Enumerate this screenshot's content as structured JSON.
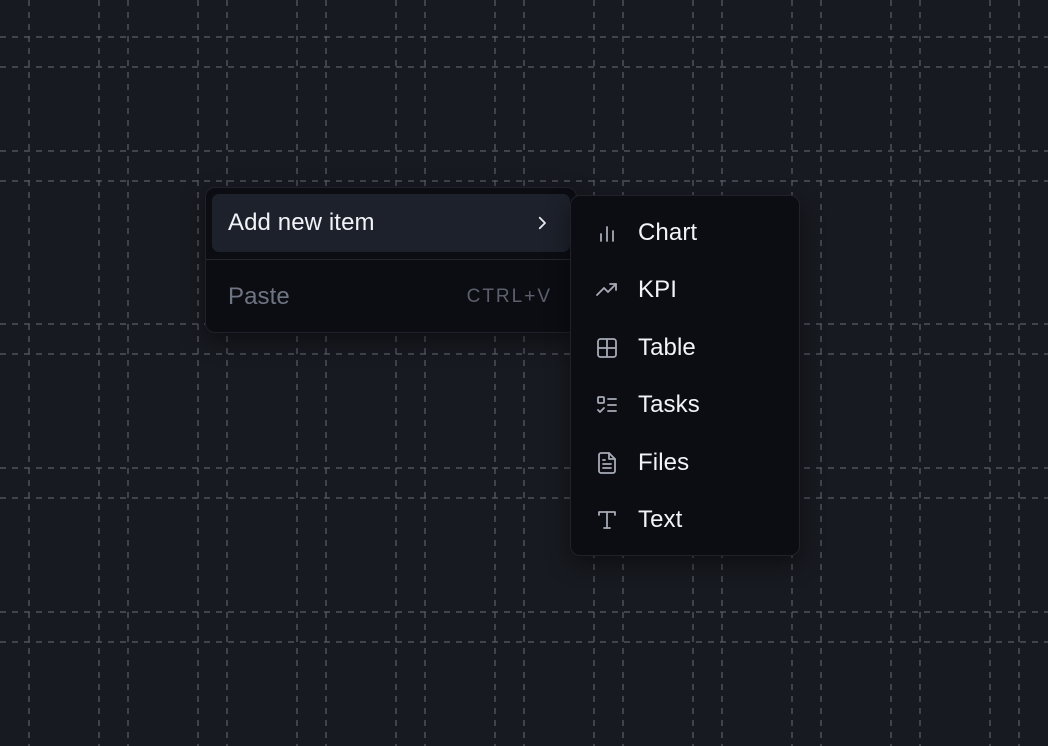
{
  "context_menu": {
    "add_item_label": "Add new item",
    "paste_label": "Paste",
    "paste_shortcut": "CTRL+V"
  },
  "submenu": {
    "items": [
      {
        "label": "Chart",
        "icon": "bar-chart-icon"
      },
      {
        "label": "KPI",
        "icon": "trending-up-icon"
      },
      {
        "label": "Table",
        "icon": "table-grid-icon"
      },
      {
        "label": "Tasks",
        "icon": "task-list-icon"
      },
      {
        "label": "Files",
        "icon": "file-icon"
      },
      {
        "label": "Text",
        "icon": "text-type-icon"
      }
    ]
  },
  "colors": {
    "background": "#181a21",
    "menu_background": "#0b0d13",
    "highlight": "#1d212b",
    "text": "#f1f3f7",
    "muted_text": "#6f7482",
    "icon": "#a6abb6"
  }
}
